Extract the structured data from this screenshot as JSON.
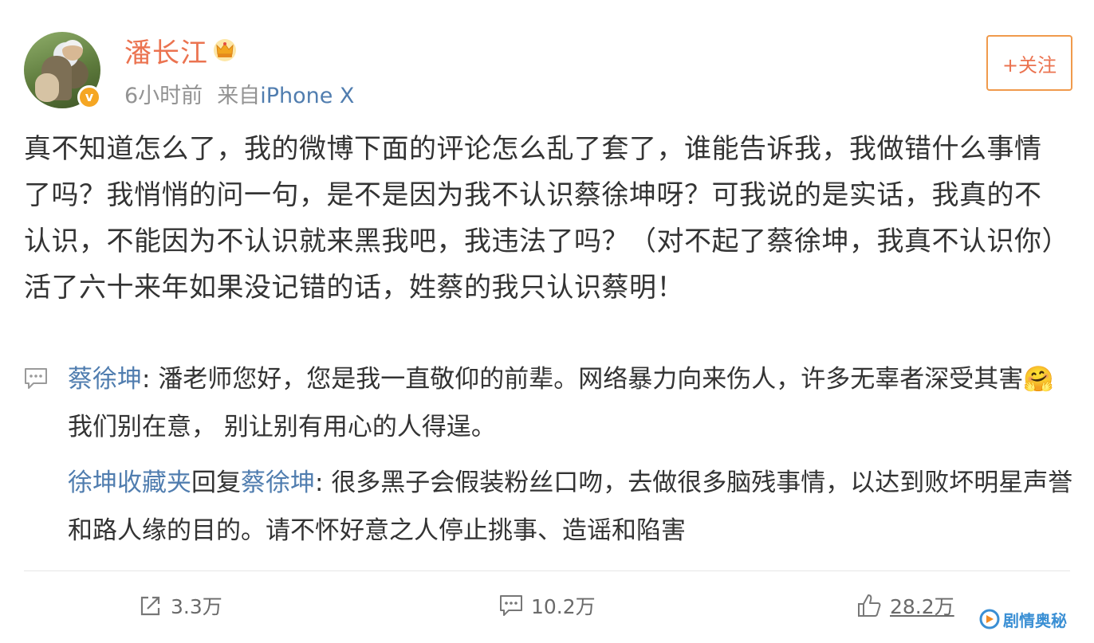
{
  "user": {
    "name": "潘长江",
    "time": "6小时前",
    "from_label": "来自",
    "device": "iPhone X",
    "verified_mark": "v"
  },
  "follow_button": {
    "label": "+关注"
  },
  "post": {
    "text": "真不知道怎么了，我的微博下面的评论怎么乱了套了，谁能告诉我，我做错什么事情了吗？我悄悄的问一句，是不是因为我不认识蔡徐坤呀？可我说的是实话，我真的不认识，不能因为不认识就来黑我吧，我违法了吗？（对不起了蔡徐坤，我真不认识你）活了六十来年如果没记错的话，姓蔡的我只认识蔡明！"
  },
  "comments": [
    {
      "author": "蔡徐坤",
      "separator": ": ",
      "text_before_emoji": "潘老师您好，您是我一直敬仰的前辈。网络暴力向来伤人，许多无辜者深受其害",
      "emoji": "🤗",
      "text_after_emoji": "我们别在意， 别让别有用心的人得逞。"
    },
    {
      "author": "徐坤收藏夹",
      "reply_label": "回复",
      "reply_to": "蔡徐坤",
      "separator": ": ",
      "text": "很多黑子会假装粉丝口吻，去做很多脑残事情，以达到败坏明星声誉和路人缘的目的。请不怀好意之人停止挑事、造谣和陷害"
    }
  ],
  "actions": {
    "repost_count": "3.3万",
    "comment_count": "10.2万",
    "like_count": "28.2万"
  },
  "watermark": {
    "text": "剧情奥秘"
  },
  "colors": {
    "username": "#eb7350",
    "link": "#507daf",
    "follow_border": "#f09a4c",
    "verified": "#f5a623",
    "meta": "#939393"
  },
  "icons": [
    "crown-icon",
    "verified-icon",
    "comment-bubble-icon",
    "repost-icon",
    "comment-icon",
    "like-icon",
    "watermark-logo-icon"
  ]
}
